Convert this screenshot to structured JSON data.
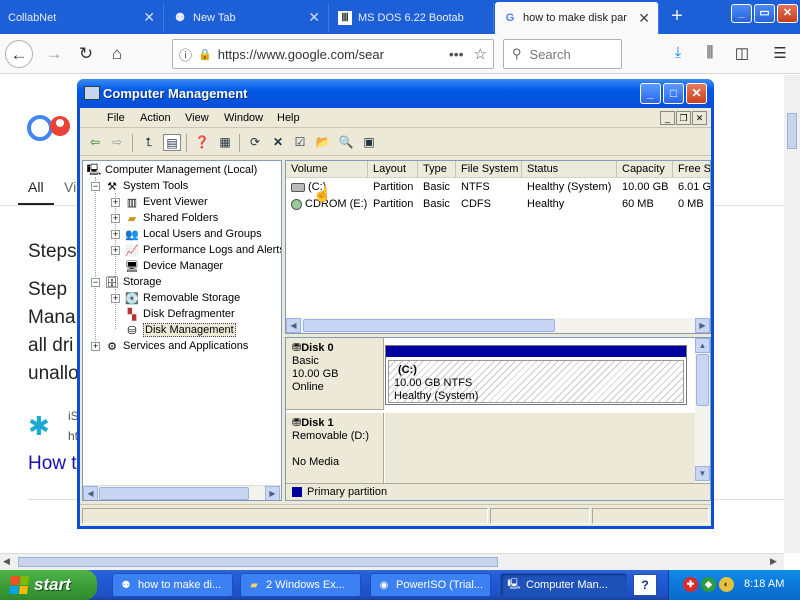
{
  "browser": {
    "tabs": [
      {
        "title": "CollabNet",
        "favicon": "none",
        "active": false
      },
      {
        "title": "New Tab",
        "favicon": "ninja-icon",
        "active": false
      },
      {
        "title": "MS DOS 6.22 Bootab",
        "favicon": "columns-icon",
        "active": false
      },
      {
        "title": "how to make disk par",
        "favicon": "google-icon",
        "active": true
      }
    ],
    "new_tab_symbol": "+",
    "url": "https://www.google.com/sear",
    "search_placeholder": "Search",
    "window_controls": {
      "minimize": "_",
      "maximize": "▭",
      "close": "✕"
    }
  },
  "webpage": {
    "tab_all": "All",
    "tab_partial": "Vi",
    "heading_partial": "Steps",
    "lines": [
      "Step",
      "Mana",
      "all dri",
      "unallo"
    ],
    "author_initial": "iS",
    "author_line2": "ht",
    "link_partial": "How t"
  },
  "window": {
    "title": "Computer Management",
    "menu": [
      "File",
      "Action",
      "View",
      "Window",
      "Help"
    ]
  },
  "tree": {
    "root": "Computer Management (Local)",
    "items": [
      {
        "label": "System Tools",
        "level": 1,
        "expander": "−",
        "icon": "tools-icon"
      },
      {
        "label": "Event Viewer",
        "level": 2,
        "expander": "+",
        "icon": "event-viewer-icon"
      },
      {
        "label": "Shared Folders",
        "level": 2,
        "expander": "+",
        "icon": "shared-folder-icon"
      },
      {
        "label": "Local Users and Groups",
        "level": 2,
        "expander": "+",
        "icon": "users-icon"
      },
      {
        "label": "Performance Logs and Alerts",
        "level": 2,
        "expander": "+",
        "icon": "performance-icon"
      },
      {
        "label": "Device Manager",
        "level": 2,
        "expander": "",
        "icon": "device-manager-icon"
      },
      {
        "label": "Storage",
        "level": 1,
        "expander": "−",
        "icon": "storage-icon"
      },
      {
        "label": "Removable Storage",
        "level": 2,
        "expander": "+",
        "icon": "removable-storage-icon"
      },
      {
        "label": "Disk Defragmenter",
        "level": 2,
        "expander": "",
        "icon": "defrag-icon"
      },
      {
        "label": "Disk Management",
        "level": 2,
        "expander": "",
        "icon": "disk-management-icon",
        "selected": true
      },
      {
        "label": "Services and Applications",
        "level": 1,
        "expander": "+",
        "icon": "services-icon"
      }
    ]
  },
  "volumes": {
    "columns": [
      "Volume",
      "Layout",
      "Type",
      "File System",
      "Status",
      "Capacity",
      "Free S"
    ],
    "rows": [
      [
        "(C:)",
        "Partition",
        "Basic",
        "NTFS",
        "Healthy (System)",
        "10.00 GB",
        "6.01 G"
      ],
      [
        "CDROM (E:)",
        "Partition",
        "Basic",
        "CDFS",
        "Healthy",
        "60 MB",
        "0 MB"
      ]
    ]
  },
  "disks": [
    {
      "name": "Disk 0",
      "type": "Basic",
      "size": "10.00 GB",
      "state": "Online"
    },
    {
      "name": "Disk 1",
      "type": "Removable (D:)",
      "size": "",
      "state": "No Media"
    }
  ],
  "partition_c": {
    "label": "(C:)",
    "detail": "10.00 GB NTFS",
    "status": "Healthy (System)"
  },
  "legend": {
    "label": "Primary partition",
    "color": "#0000a0"
  },
  "taskbar": {
    "start_label": "start",
    "buttons": [
      {
        "label": "how to make di...",
        "icon": "firefox-icon",
        "active": false
      },
      {
        "label": "2 Windows Ex...",
        "icon": "folder-icon",
        "active": false
      },
      {
        "label": "PowerISO (Trial...",
        "icon": "poweriso-icon",
        "active": false
      },
      {
        "label": "Computer Man...",
        "icon": "computer-management-icon",
        "active": true
      }
    ],
    "help_symbol": "?",
    "clock": "8:18 AM"
  },
  "colors": {
    "xp_blue": "#0a4fd6",
    "taskbar_blue": "#245edb",
    "start_green": "#3c9d38",
    "tray_blue": "#0b77d8"
  }
}
